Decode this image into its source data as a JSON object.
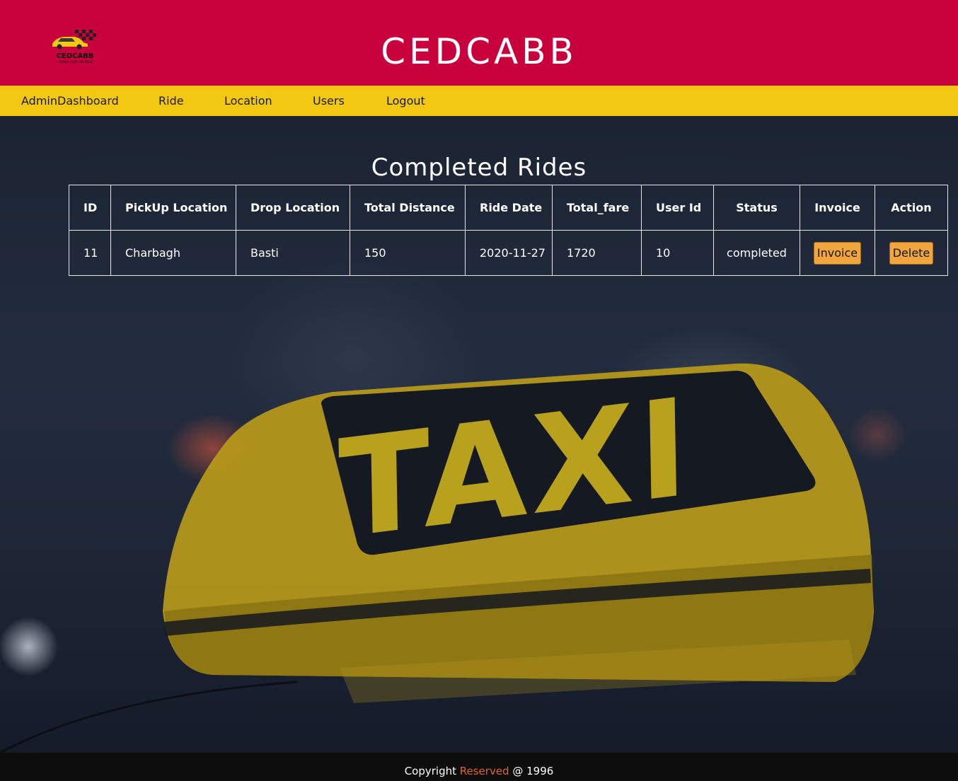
{
  "brand": {
    "title": "CEDCABB",
    "logo_text": "CEDCABB",
    "logo_tagline": "DRIVER AND DECIDER"
  },
  "nav": {
    "items": [
      {
        "label": "AdminDashboard"
      },
      {
        "label": "Ride"
      },
      {
        "label": "Location"
      },
      {
        "label": "Users"
      },
      {
        "label": "Logout"
      }
    ]
  },
  "hero": {
    "sign_text": "TAXI"
  },
  "main": {
    "heading": "Completed Rides",
    "columns": [
      "ID",
      "PickUp Location",
      "Drop Location",
      "Total Distance",
      "Ride Date",
      "Total_fare",
      "User Id",
      "Status",
      "Invoice",
      "Action"
    ],
    "rows": [
      {
        "id": "11",
        "pickup": "Charbagh",
        "drop": "Basti",
        "distance": "150",
        "date": "2020-11-27",
        "fare": "1720",
        "user_id": "10",
        "status": "completed",
        "invoice_label": "Invoice",
        "action_label": "Delete"
      }
    ]
  },
  "footer": {
    "prefix": "Copyright ",
    "highlight": "Reserved",
    "suffix": " @ 1996"
  },
  "colors": {
    "header_bg": "#c8003c",
    "nav_bg": "#f2c812",
    "button_bg": "#f0a63c",
    "footer_accent": "#e0642a"
  }
}
